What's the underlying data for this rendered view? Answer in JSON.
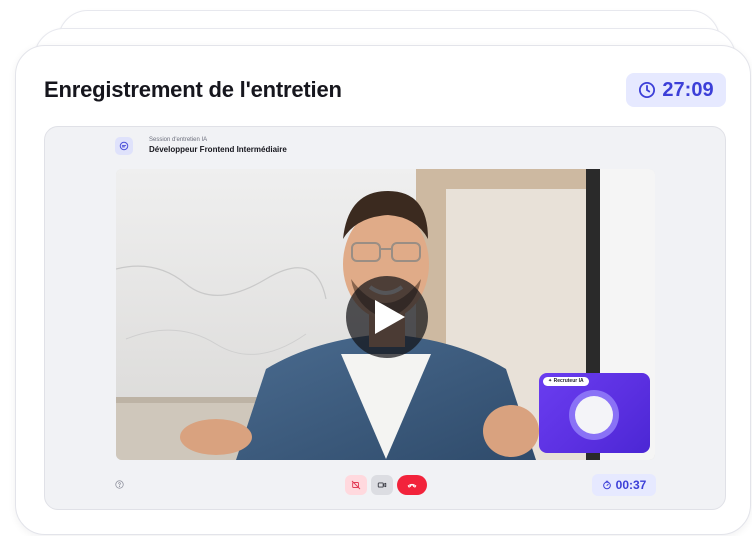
{
  "header": {
    "title": "Enregistrement de l'entretien",
    "timer": "27:09"
  },
  "session": {
    "label": "Session d'entretien IA",
    "title": "Développeur Frontend Intermédiaire"
  },
  "ai_overlay": {
    "tag": "✦ Recruteur IA"
  },
  "controls": {
    "elapsed": "00:37"
  },
  "icons": {
    "timer": "clock-icon",
    "session": "chat-bubble-icon",
    "play": "play-icon",
    "help": "help-circle-icon",
    "camera_off": "camera-off-icon",
    "video": "video-camera-icon",
    "hangup": "phone-hangup-icon",
    "elapsed": "stopwatch-icon"
  },
  "colors": {
    "accent": "#3c3fd8",
    "accent_bg": "#e6e9ff",
    "hangup": "#f2233b",
    "ai_purple": "#5a2fe0"
  }
}
